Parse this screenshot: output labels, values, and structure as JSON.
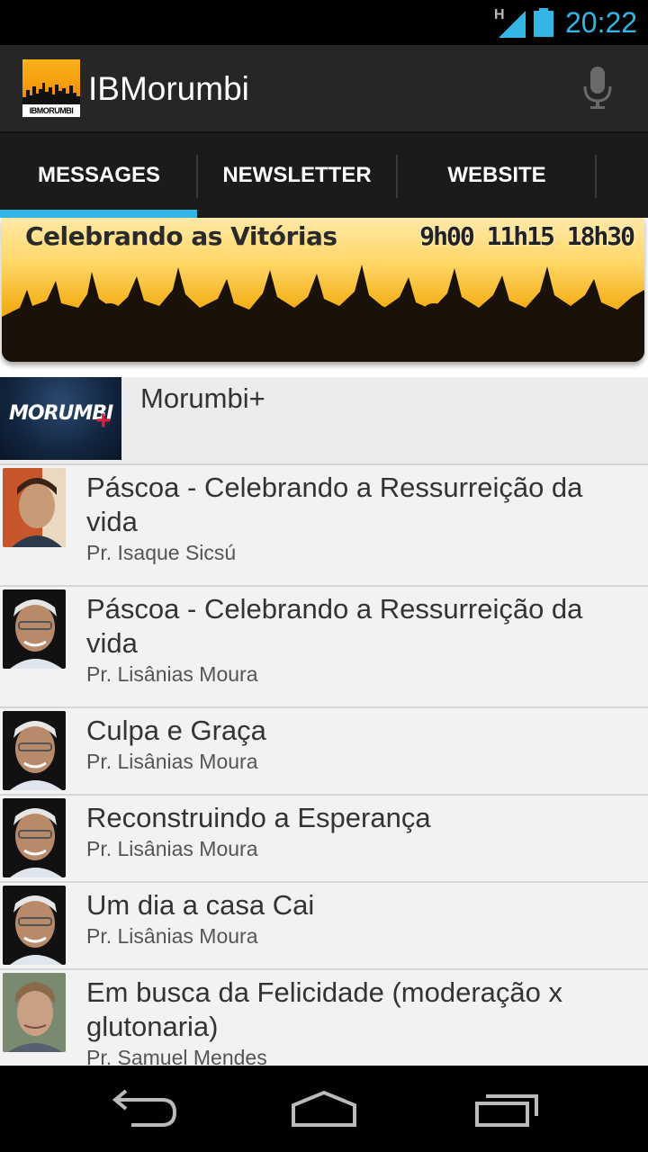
{
  "status_bar": {
    "network_type": "H",
    "time": "20:22",
    "icons": [
      "signal-icon",
      "battery-icon"
    ]
  },
  "action_bar": {
    "app_title": "IBMorumbi",
    "logo_text": "IBMORUMBI",
    "icons": [
      "app-logo",
      "mic-icon"
    ]
  },
  "tabs": [
    {
      "label": "MESSAGES",
      "selected": true
    },
    {
      "label": "NEWSLETTER",
      "selected": false
    },
    {
      "label": "WEBSITE",
      "selected": false
    }
  ],
  "banner": {
    "title": "Celebrando as Vitórias",
    "times": "9h00 11h15 18h30"
  },
  "featured": {
    "thumb_text": "MORUMBI",
    "thumb_plus": "+",
    "title": "Morumbi+"
  },
  "messages": [
    {
      "title": "Páscoa - Celebrando a Ressurreição da vida",
      "author": "Pr. Isaque Sicsú"
    },
    {
      "title": "Páscoa - Celebrando a Ressurreição da vida",
      "author": "Pr. Lisânias Moura"
    },
    {
      "title": "Culpa e Graça",
      "author": "Pr. Lisânias Moura"
    },
    {
      "title": "Reconstruindo a Esperança",
      "author": "Pr. Lisânias Moura"
    },
    {
      "title": "Um dia a casa Cai",
      "author": "Pr. Lisânias Moura"
    },
    {
      "title": "Em busca da Felicidade (moderação x glutonaria)",
      "author": "Pr. Samuel Mendes"
    }
  ],
  "nav_bar": {
    "icons": [
      "back-icon",
      "home-icon",
      "recents-icon"
    ]
  },
  "colors": {
    "accent": "#33b5e5",
    "action_bar": "#262626",
    "tabs_bg": "#1b1b1b",
    "list_bg": "#f2f2f2"
  }
}
